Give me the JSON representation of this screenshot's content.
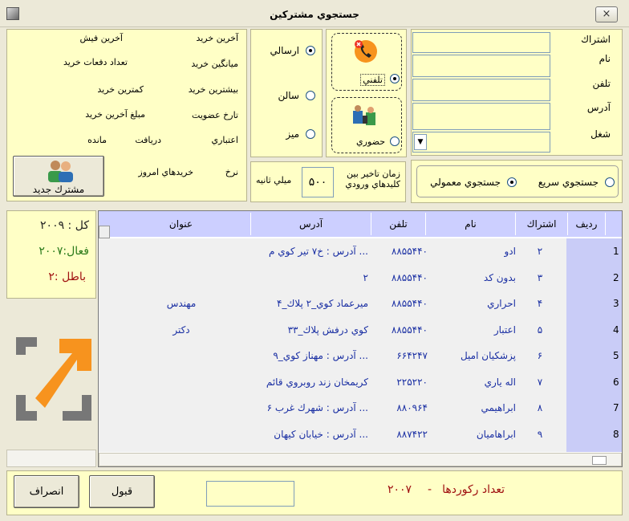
{
  "window": {
    "title": "جستجوي مشتركين",
    "close_label": "×"
  },
  "search_fields": [
    {
      "label": "اشتراك",
      "value": ""
    },
    {
      "label": "نام",
      "value": ""
    },
    {
      "label": "تلفن",
      "value": ""
    },
    {
      "label": "آدرس",
      "value": ""
    },
    {
      "label": "شغل",
      "value": ""
    }
  ],
  "contact_mode": {
    "phone_label": "تلفني",
    "visit_label": "حضوري",
    "selected": "تلفني"
  },
  "delivery": {
    "options": [
      "ارسالي",
      "سالن",
      "ميز"
    ],
    "selected": "ارسالي"
  },
  "customer_info": {
    "labels": [
      "آخرين خريد",
      "آخرين فيش",
      "ميانگين خريد",
      "تعداد دفعات خريد",
      "بيشترين خريد",
      "كمترين خريد",
      "تارخ عضويت",
      "مبلغ آخرين خريد",
      "اعتباري",
      "دريافت",
      "مانده",
      "نرخ",
      "خريدهاي امروز"
    ],
    "new_customer_label": "مشترك جديد"
  },
  "delay": {
    "label": "زمان تاخير بين كليدهاي ورودي",
    "value": "۵۰۰",
    "unit": "ميلي ثانيه"
  },
  "search_mode": {
    "quick": "جستجوي سريع",
    "normal": "جستجوي معمولي",
    "selected": "جستجوي معمولي"
  },
  "stats": {
    "total": "كل : ۲۰۰۹",
    "active": "فعال:۲۰۰۷",
    "void": "باطل :۲"
  },
  "grid": {
    "headers": [
      "رديف",
      "اشتراك",
      "نام",
      "تلفن",
      "آدرس",
      "عنوان"
    ],
    "rows": [
      {
        "row": "1",
        "sub": "۲",
        "name": "ادو",
        "phone": "۸۸۵۵۴۴۰",
        "address": "... آدرس : خ۷ تير كوي م",
        "title": ""
      },
      {
        "row": "2",
        "sub": "۳",
        "name": "بدون كد",
        "phone": "۸۸۵۵۴۴۰",
        "address": "۲",
        "title": ""
      },
      {
        "row": "3",
        "sub": "۴",
        "name": "احراري",
        "phone": "۸۸۵۵۴۴۰",
        "address": "ميرعماد كوي_۲ پلاك_۴",
        "title": "مهندس"
      },
      {
        "row": "4",
        "sub": "۵",
        "name": "اعتبار",
        "phone": "۸۸۵۵۴۴۰",
        "address": "كوي درفش پلاك_۳۳",
        "title": "دكتر"
      },
      {
        "row": "5",
        "sub": "۶",
        "name": "پزشكيان اميل",
        "phone": "۶۶۴۲۴۷",
        "address": "... آدرس : مهناز كوي_۹",
        "title": ""
      },
      {
        "row": "6",
        "sub": "۷",
        "name": "اله ياري",
        "phone": "۲۲۵۲۲۰",
        "address": "كريمخان زند روبروي قائم",
        "title": ""
      },
      {
        "row": "7",
        "sub": "۸",
        "name": "ابراهيمي",
        "phone": "۸۸۰۹۶۴",
        "address": "... آدرس : شهرك غرب ۶",
        "title": ""
      },
      {
        "row": "8",
        "sub": "۹",
        "name": "ابراهاميان",
        "phone": "۸۸۷۴۲۲",
        "address": "... آدرس : خيابان كيهان",
        "title": ""
      }
    ]
  },
  "footer": {
    "record_count_label": "تعداد ركوردها",
    "record_count_sep": "-",
    "record_count": "۲۰۰۷",
    "ok_label": "قبول",
    "cancel_label": "انصراف",
    "field_value": ""
  },
  "colors": {
    "panel_bg": "#ffffc6",
    "grid_header": "#cccfff",
    "accent_orange": "#f7931e",
    "grid_text": "#1a2fa3"
  }
}
